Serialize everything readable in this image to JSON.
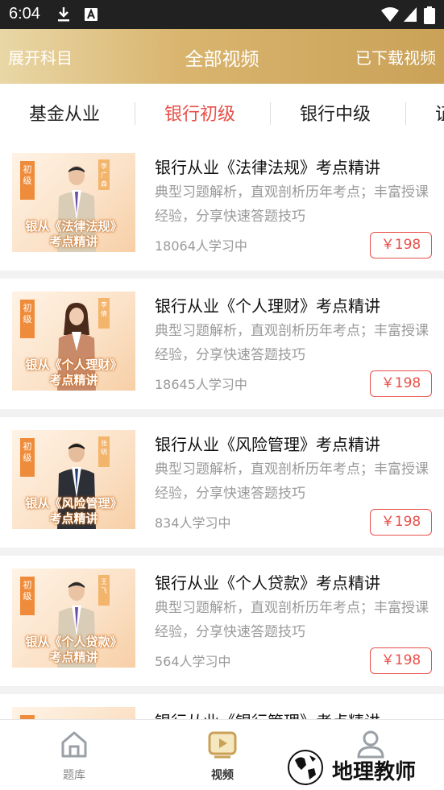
{
  "status_bar": {
    "time": "6:04"
  },
  "header": {
    "left": "展开科目",
    "title": "全部视频",
    "right": "已下载视频"
  },
  "tabs": [
    {
      "label": "基金从业",
      "active": false
    },
    {
      "label": "银行初级",
      "active": true
    },
    {
      "label": "银行中级",
      "active": false
    },
    {
      "label": "证",
      "active": false
    }
  ],
  "courses": [
    {
      "tag": "初级",
      "teacher": "李广森",
      "cap1": "银从《法律法规》",
      "cap2": "考点精讲",
      "title": "银行从业《法律法规》考点精讲",
      "desc": "典型习题解析，直观剖析历年考点；丰富授课经验，分享快速答题技巧",
      "learners": "18064人学习中",
      "price": "￥198"
    },
    {
      "tag": "初级",
      "teacher": "李倩",
      "cap1": "银从《个人理财》",
      "cap2": "考点精讲",
      "title": "银行从业《个人理财》考点精讲",
      "desc": "典型习题解析，直观剖析历年考点；丰富授课经验，分享快速答题技巧",
      "learners": "18645人学习中",
      "price": "￥198"
    },
    {
      "tag": "初级",
      "teacher": "张明",
      "cap1": "银从《风险管理》",
      "cap2": "考点精讲",
      "title": "银行从业《风险管理》考点精讲",
      "desc": "典型习题解析，直观剖析历年考点；丰富授课经验，分享快速答题技巧",
      "learners": "834人学习中",
      "price": "￥198"
    },
    {
      "tag": "初级",
      "teacher": "王飞",
      "cap1": "银从《个人贷款》",
      "cap2": "考点精讲",
      "title": "银行从业《个人贷款》考点精讲",
      "desc": "典型习题解析，直观剖析历年考点；丰富授课经验，分享快速答题技巧",
      "learners": "564人学习中",
      "price": "￥198"
    },
    {
      "tag": "初级",
      "teacher": "",
      "cap1": "",
      "cap2": "",
      "title": "银行从业《银行管理》考点精讲",
      "desc": "",
      "learners": "",
      "price": ""
    }
  ],
  "bottom_nav": [
    {
      "label": "题库",
      "icon": "house-icon",
      "active": false
    },
    {
      "label": "视频",
      "icon": "video-icon",
      "active": true
    },
    {
      "label": "",
      "icon": "profile-icon",
      "active": false
    }
  ],
  "watermark": {
    "text": "地理教师"
  },
  "colors": {
    "accent": "#e8504a",
    "header_gold": "#d9b56f",
    "tag_orange": "#ef8c3b"
  }
}
